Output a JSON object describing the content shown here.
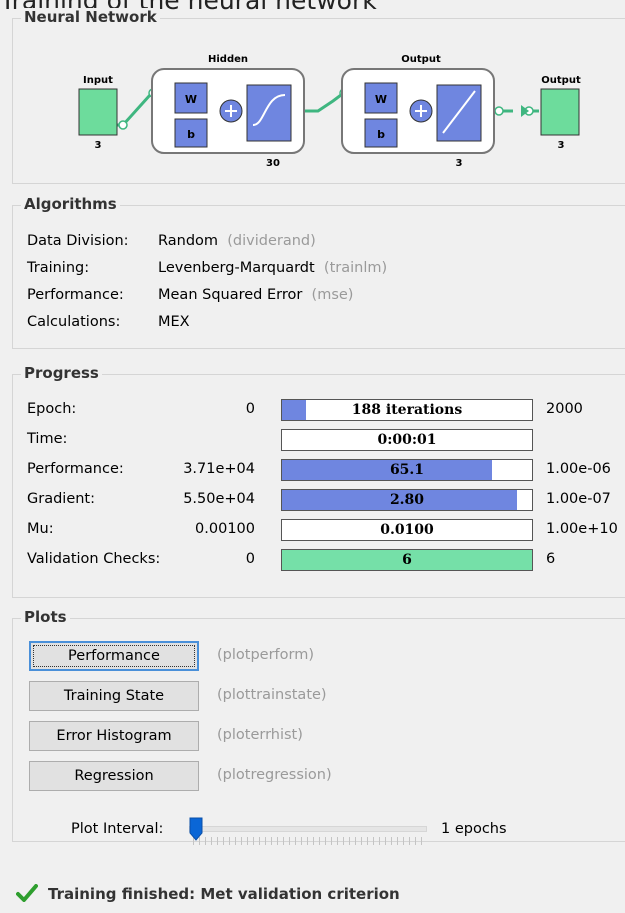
{
  "window_title": "Training of the neural network",
  "neural_network": {
    "label": "Neural Network",
    "input": {
      "title": "Input",
      "size": "3"
    },
    "hidden": {
      "title": "Hidden",
      "size": "30",
      "w": "W",
      "b": "b"
    },
    "output_layer": {
      "title": "Output",
      "size": "3",
      "w": "W",
      "b": "b"
    },
    "output": {
      "title": "Output",
      "size": "3"
    },
    "colors": {
      "node": "#6ddc9c",
      "weight": "#6f86e0",
      "connector": "#3fb680"
    }
  },
  "algorithms": {
    "label": "Algorithms",
    "rows": [
      {
        "key": "Data Division:",
        "value": "Random",
        "fn": "(dividerand)"
      },
      {
        "key": "Training:",
        "value": "Levenberg-Marquardt",
        "fn": "(trainlm)"
      },
      {
        "key": "Performance:",
        "value": "Mean Squared Error",
        "fn": "(mse)"
      },
      {
        "key": "Calculations:",
        "value": "MEX",
        "fn": ""
      }
    ]
  },
  "progress": {
    "label": "Progress",
    "rows": [
      {
        "name": "Epoch:",
        "start": "0",
        "current": "188 iterations",
        "end": "2000",
        "fill": 0.094,
        "color": "blue"
      },
      {
        "name": "Time:",
        "start": "",
        "current": "0:00:01",
        "end": "",
        "fill": 0,
        "color": "blue"
      },
      {
        "name": "Performance:",
        "start": "3.71e+04",
        "current": "65.1",
        "end": "1.00e-06",
        "fill": 0.84,
        "color": "blue"
      },
      {
        "name": "Gradient:",
        "start": "5.50e+04",
        "current": "2.80",
        "end": "1.00e-07",
        "fill": 0.94,
        "color": "blue"
      },
      {
        "name": "Mu:",
        "start": "0.00100",
        "current": "0.0100",
        "end": "1.00e+10",
        "fill": 0,
        "color": "blue"
      },
      {
        "name": "Validation Checks:",
        "start": "0",
        "current": "6",
        "end": "6",
        "fill": 1.0,
        "color": "green"
      }
    ]
  },
  "plots": {
    "label": "Plots",
    "buttons": [
      {
        "label": "Performance",
        "fn": "(plotperform)"
      },
      {
        "label": "Training State",
        "fn": "(plottrainstate)"
      },
      {
        "label": "Error Histogram",
        "fn": "(ploterrhist)"
      },
      {
        "label": "Regression",
        "fn": "(plotregression)"
      }
    ],
    "interval_label": "Plot Interval:",
    "interval_value": "1 epochs",
    "interval_level": 0
  },
  "status": {
    "text": "Training finished: Met validation criterion",
    "icon": "checkmark-icon",
    "color": "#2e9e2e"
  }
}
